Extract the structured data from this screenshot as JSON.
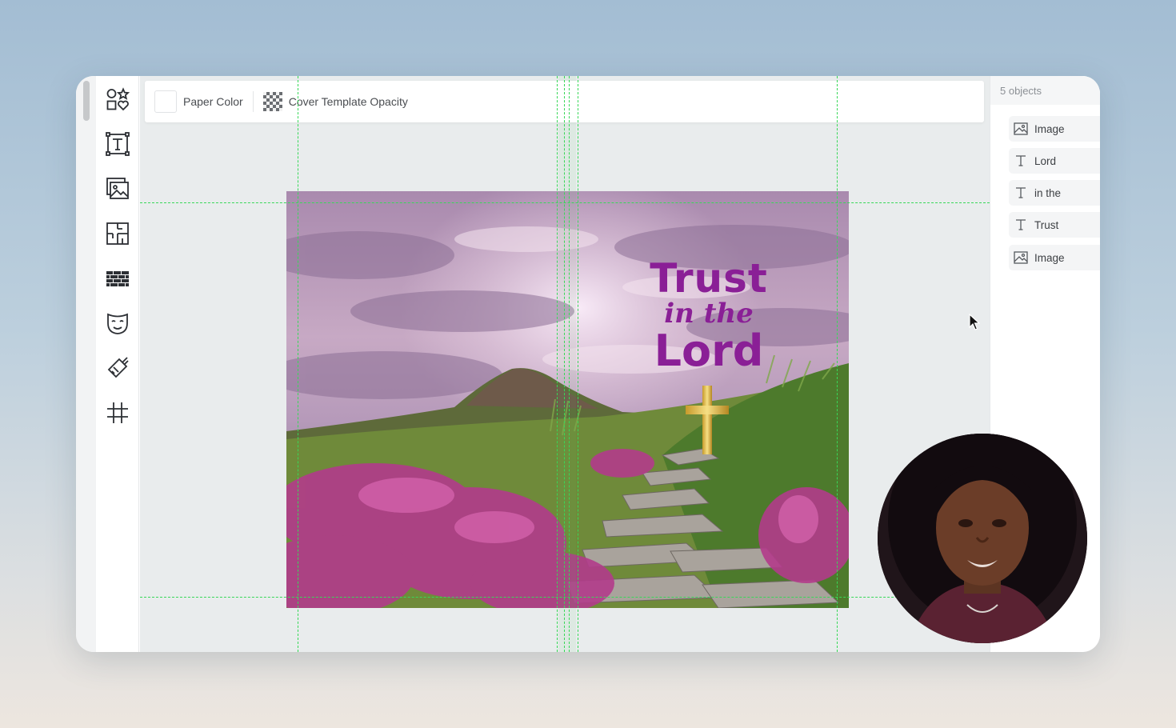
{
  "top_bar": {
    "paper_color_label": "Paper Color",
    "opacity_label": "Cover Template Opacity"
  },
  "toolbar": {
    "tools": [
      "shapes-icon",
      "text-tool-icon",
      "image-tool-icon",
      "puzzle-tool-icon",
      "pattern-tool-icon",
      "mask-tool-icon",
      "brush-tool-icon",
      "grid-tool-icon"
    ]
  },
  "cover": {
    "title_line1": "Trust",
    "title_line2": "in the",
    "title_line3": "Lord",
    "title_color": "#8a1f96"
  },
  "layers_panel": {
    "header": "5 objects",
    "items": [
      {
        "type": "image",
        "label": "Image"
      },
      {
        "type": "text",
        "label": "Lord"
      },
      {
        "type": "text",
        "label": "in the"
      },
      {
        "type": "text",
        "label": "Trust"
      },
      {
        "type": "image",
        "label": "Image"
      }
    ]
  }
}
